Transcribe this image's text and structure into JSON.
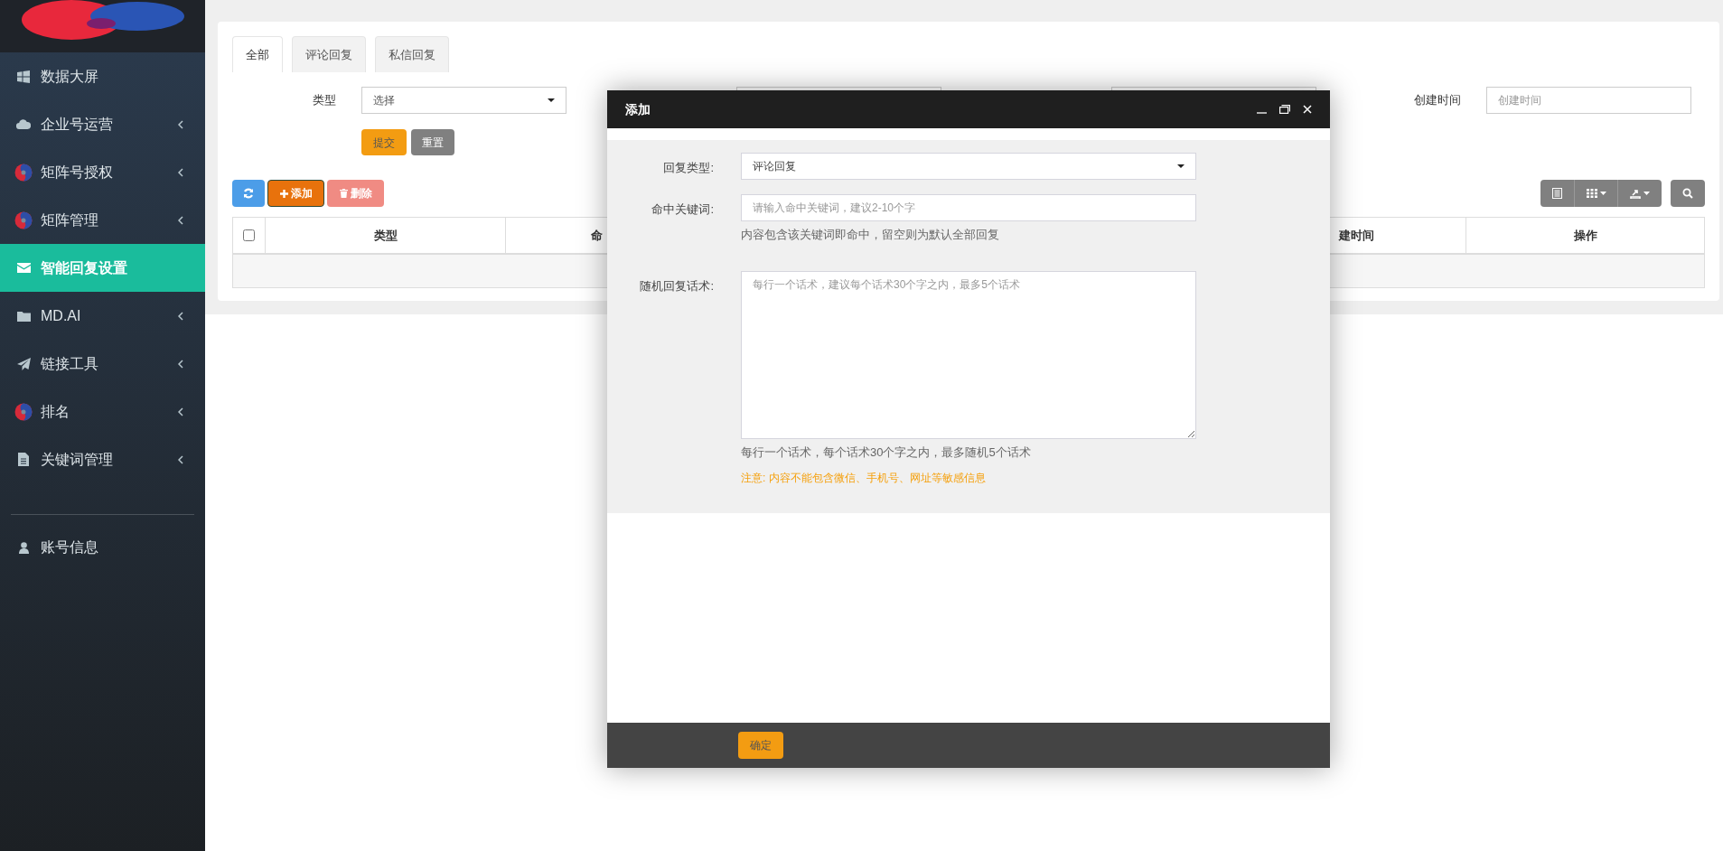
{
  "sidebar": {
    "items": [
      {
        "label": "数据大屏",
        "expandable": false,
        "selected": false
      },
      {
        "label": "企业号运营",
        "expandable": true,
        "selected": false
      },
      {
        "label": "矩阵号授权",
        "expandable": true,
        "selected": false
      },
      {
        "label": "矩阵管理",
        "expandable": true,
        "selected": false
      },
      {
        "label": "智能回复设置",
        "expandable": false,
        "selected": true
      },
      {
        "label": "MD.AI",
        "expandable": true,
        "selected": false
      },
      {
        "label": "链接工具",
        "expandable": true,
        "selected": false
      },
      {
        "label": "排名",
        "expandable": true,
        "selected": false
      },
      {
        "label": "关键词管理",
        "expandable": true,
        "selected": false
      }
    ],
    "account": "账号信息"
  },
  "tabs": [
    {
      "label": "全部",
      "selected": true
    },
    {
      "label": "评论回复",
      "selected": false
    },
    {
      "label": "私信回复",
      "selected": false
    }
  ],
  "filters": {
    "type_label": "类型",
    "type_value": "选择",
    "created_label": "创建时间",
    "created_placeholder": "创建时间",
    "submit": "提交",
    "reset": "重置"
  },
  "toolbar": {
    "add": "添加",
    "delete": "删除"
  },
  "table": {
    "select_all_checked": false,
    "columns": [
      "类型",
      "命",
      "建时间",
      "操作"
    ]
  },
  "dialog": {
    "title": "添加",
    "fields": [
      {
        "kind": "select",
        "label": "回复类型:",
        "value": "评论回复"
      },
      {
        "kind": "input",
        "label": "命中关键词:",
        "placeholder": "请输入命中关键词，建议2-10个字",
        "help": "内容包含该关键词即命中，留空则为默认全部回复"
      },
      {
        "kind": "textarea",
        "label": "随机回复话术:",
        "placeholder": "每行一个话术，建议每个话术30个字之内，最多5个话术",
        "help": "每行一个话术，每个话术30个字之内，最多随机5个话术",
        "warning": "注意: 内容不能包含微信、手机号、网址等敏感信息"
      }
    ],
    "confirm": "确定"
  }
}
